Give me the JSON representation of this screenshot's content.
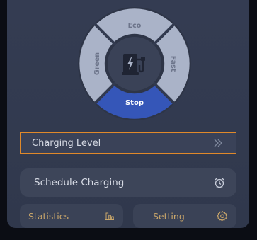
{
  "mode_dial": {
    "segments": {
      "top": "Eco",
      "right": "Fast",
      "bottom": "Stop",
      "left": "Green"
    },
    "active_segment": "Stop",
    "center_icon": "ev-charger-icon",
    "colors": {
      "segment": "#a9b3c9",
      "active": "#3556b8",
      "segment_text": "#6c748a",
      "active_text": "#ffffff"
    }
  },
  "menu": {
    "charging_level": {
      "label": "Charging Level",
      "icon": "double-chevron-right-icon",
      "border_color": "#e0892a"
    },
    "schedule_charging": {
      "label": "Schedule Charging",
      "icon": "alarm-clock-icon"
    },
    "statistics": {
      "label": "Statistics",
      "icon": "bar-chart-icon"
    },
    "setting": {
      "label": "Setting",
      "icon": "gear-icon"
    }
  }
}
